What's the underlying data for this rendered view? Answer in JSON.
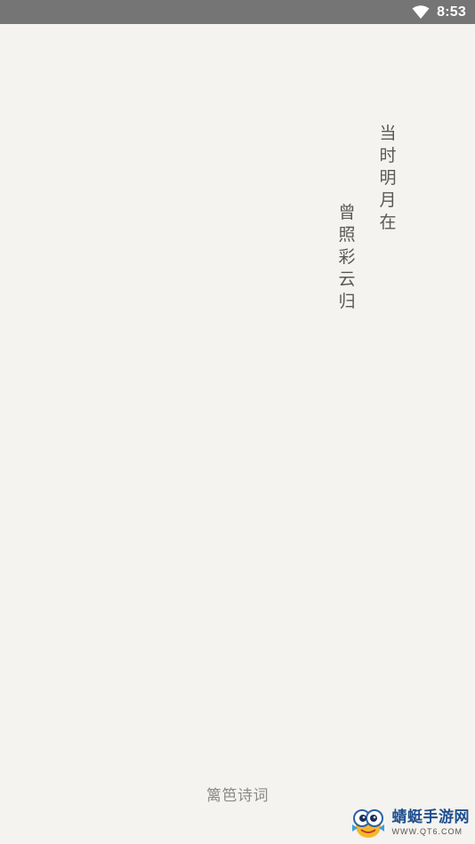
{
  "status_bar": {
    "time": "8:53",
    "icons": [
      "wifi-icon"
    ]
  },
  "poem": {
    "line1": "当时明月在",
    "line2": "曾照彩云归"
  },
  "app": {
    "name": "篱笆诗词"
  },
  "watermark": {
    "title": "蜻蜓手游网",
    "url": "WWW.QT6.COM"
  },
  "colors": {
    "background": "#f4f3ef",
    "status_bar": "#757575",
    "poem_text": "#595959",
    "app_name": "#8a8a8a"
  }
}
